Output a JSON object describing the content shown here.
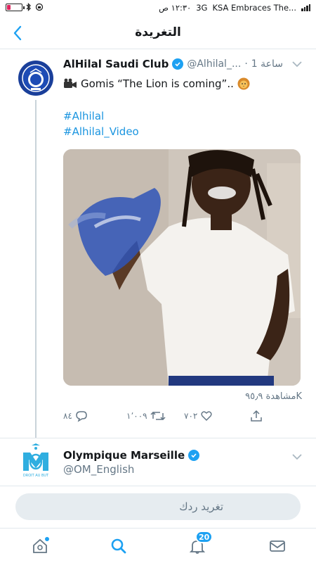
{
  "status_bar": {
    "time": "١٢:٣٠ ص",
    "network": "3G",
    "carrier": "KSA Embraces The..."
  },
  "header": {
    "title": "التغريدة"
  },
  "tweet": {
    "name": "AlHilal Saudi Club",
    "handle": "@Alhilal_...",
    "separator": "·",
    "time_ago": "1 ساعة",
    "text": "Gomis “The Lion is coming”..",
    "hashtags": [
      "#Alhilal",
      "#Alhilal_Video"
    ],
    "views": "مشاهدة ٩٥٫٩K",
    "reply_count": "٨٤",
    "retweet_count": "١٬٠٠٩",
    "like_count": "٧٠٢"
  },
  "next_tweet": {
    "name": "Olympique Marseille",
    "handle": "@OM_English",
    "avatar_caption": "DROIT AU BUT"
  },
  "reply": {
    "placeholder": "تغريد ردك"
  },
  "tab_bar": {
    "notifications_badge": "20"
  },
  "colors": {
    "accent": "#1da1f2",
    "link": "#1b95e0",
    "muted": "#657786",
    "hilal_blue": "#1a3f9a"
  }
}
